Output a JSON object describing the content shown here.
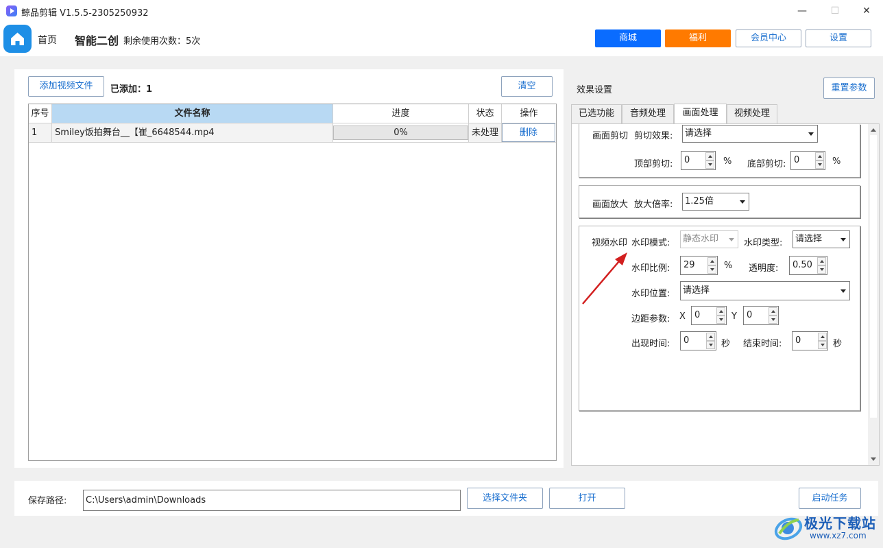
{
  "window": {
    "title": "鲸品剪辑 V1.5.5-2305250932",
    "minimize": "—",
    "maximize": "☐",
    "close": "✕"
  },
  "header": {
    "home_label": "首页",
    "module_title": "智能二创",
    "remaining_label": "剩余使用次数：5次",
    "buttons": {
      "shop": "商城",
      "welfare": "福利",
      "member": "会员中心",
      "settings": "设置"
    },
    "colors": {
      "shop_bg": "#0a6cff",
      "welfare_bg": "#ff7a00"
    }
  },
  "file_panel": {
    "add_button": "添加视频文件",
    "added_count": "已添加：1",
    "clear_button": "清空",
    "columns": [
      "序号",
      "文件名称",
      "进度",
      "状态",
      "操作"
    ],
    "rows": [
      {
        "index": "1",
        "name": "Smiley饭拍舞台__【崔_6648544.mp4",
        "progress": "0%",
        "progress_value": 0,
        "status": "未处理",
        "action": "删除"
      }
    ]
  },
  "settings_panel": {
    "title": "效果设置",
    "reset_button": "重置参数",
    "tabs": [
      "已选功能",
      "音频处理",
      "画面处理",
      "视频处理"
    ],
    "active_tab": "画面处理",
    "crop": {
      "group_label": "画面剪切",
      "effect_label": "剪切效果:",
      "effect_value": "请选择",
      "top_label": "顶部剪切:",
      "top_value": "0",
      "top_unit": "%",
      "bottom_label": "底部剪切:",
      "bottom_value": "0",
      "bottom_unit": "%"
    },
    "zoom": {
      "group_label": "画面放大",
      "ratio_label": "放大倍率:",
      "ratio_value": "1.25倍"
    },
    "watermark": {
      "group_label": "视频水印",
      "mode_label": "水印模式:",
      "mode_value": "静态水印",
      "type_label": "水印类型:",
      "type_value": "请选择",
      "scale_label": "水印比例:",
      "scale_value": "29",
      "scale_unit": "%",
      "opacity_label": "透明度:",
      "opacity_value": "0.50",
      "position_label": "水印位置:",
      "position_value": "请选择",
      "margin_label": "边距参数:",
      "x_label": "X",
      "x_value": "0",
      "y_label": "Y",
      "y_value": "0",
      "start_label": "出现时间:",
      "start_value": "0",
      "start_unit": "秒",
      "end_label": "结束时间:",
      "end_value": "0",
      "end_unit": "秒"
    }
  },
  "bottom": {
    "save_label": "保存路径:",
    "save_path": "C:\\Users\\admin\\Downloads",
    "choose_folder": "选择文件夹",
    "open": "打开",
    "start": "启动任务"
  },
  "watermark_logo": {
    "name": "极光下载站",
    "url": "www.xz7.com"
  }
}
